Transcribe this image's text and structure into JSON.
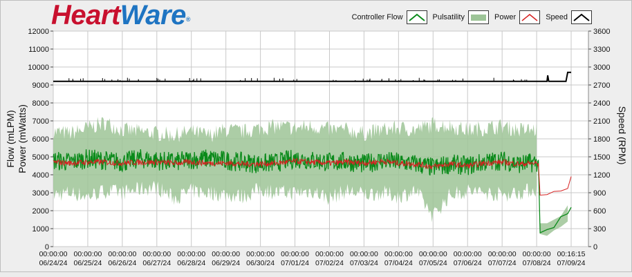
{
  "logo": {
    "part1": "Heart",
    "part2": "Ware",
    "mark": "®"
  },
  "legend": [
    {
      "label": "Controller Flow",
      "icon": "flow-swatch-icon",
      "color": "#0a8a1a"
    },
    {
      "label": "Pulsatility",
      "icon": "pulsatility-swatch-icon",
      "color": "#9dc497"
    },
    {
      "label": "Power",
      "icon": "power-swatch-icon",
      "color": "#d62020"
    },
    {
      "label": "Speed",
      "icon": "speed-swatch-icon",
      "color": "#000000"
    }
  ],
  "chart_data": {
    "type": "line",
    "ylabel_left": [
      "Flow (mLPM)",
      "Power (mWatts)"
    ],
    "ylabel_right": "Speed (RPM)",
    "ylim_left": [
      0,
      12000
    ],
    "ylim_right": [
      0,
      3600
    ],
    "yticks_left": [
      "12000",
      "11000",
      "10000",
      "9000",
      "8000",
      "7000",
      "6000",
      "5000",
      "4000",
      "3000",
      "2000",
      "1000",
      "0"
    ],
    "yticks_right": [
      "3600",
      "3300",
      "3000",
      "2700",
      "2400",
      "2100",
      "1800",
      "1500",
      "1200",
      "900",
      "600",
      "300",
      "0"
    ],
    "xticks": [
      {
        "time": "00:00:00",
        "date": "06/24/24"
      },
      {
        "time": "00:00:00",
        "date": "06/25/24"
      },
      {
        "time": "00:00:00",
        "date": "06/26/24"
      },
      {
        "time": "00:00:00",
        "date": "06/27/24"
      },
      {
        "time": "00:00:00",
        "date": "06/28/24"
      },
      {
        "time": "00:00:00",
        "date": "06/29/24"
      },
      {
        "time": "00:00:00",
        "date": "06/30/24"
      },
      {
        "time": "00:00:00",
        "date": "07/01/24"
      },
      {
        "time": "00:00:00",
        "date": "07/02/24"
      },
      {
        "time": "00:00:00",
        "date": "07/03/24"
      },
      {
        "time": "00:00:00",
        "date": "07/04/24"
      },
      {
        "time": "00:00:00",
        "date": "07/05/24"
      },
      {
        "time": "00:00:00",
        "date": "07/06/24"
      },
      {
        "time": "00:00:00",
        "date": "07/07/24"
      },
      {
        "time": "00:00:00",
        "date": "07/08/24"
      },
      {
        "time": "00:16:15",
        "date": "07/09/24"
      }
    ],
    "grid": true,
    "legend_position": "top-right",
    "series": [
      {
        "name": "Controller Flow",
        "axis": "left",
        "color": "#0a8a1a",
        "x": [
          0,
          0.5,
          1,
          1.5,
          2,
          2.5,
          3,
          3.5,
          4,
          4.5,
          5,
          5.5,
          6,
          6.5,
          7,
          7.5,
          8,
          8.5,
          9,
          9.5,
          10,
          10.5,
          11,
          11.5,
          12,
          12.5,
          13,
          13.5,
          14,
          14.05,
          14.1,
          14.3,
          14.5,
          14.7,
          14.9,
          15.0
        ],
        "y": [
          4800,
          4700,
          4900,
          4800,
          4700,
          4900,
          4800,
          4700,
          4850,
          4900,
          4800,
          4700,
          4600,
          4700,
          4900,
          4800,
          4700,
          4750,
          4600,
          4800,
          4700,
          4600,
          4400,
          4600,
          4500,
          4700,
          4800,
          4600,
          4700,
          4500,
          1000,
          900,
          1200,
          1400,
          1600,
          2200
        ]
      },
      {
        "name": "Power",
        "axis": "left",
        "color": "#d62020",
        "x": [
          0,
          0.5,
          1,
          1.5,
          2,
          2.5,
          3,
          3.5,
          4,
          4.5,
          5,
          5.5,
          6,
          6.5,
          7,
          7.5,
          8,
          8.5,
          9,
          9.5,
          10,
          10.5,
          11,
          11.5,
          12,
          12.5,
          13,
          13.5,
          14,
          14.05,
          14.1,
          14.3,
          14.5,
          14.7,
          14.9,
          15.0
        ],
        "y": [
          4700,
          4650,
          4700,
          4700,
          4650,
          4700,
          4700,
          4650,
          4700,
          4650,
          4650,
          4600,
          4600,
          4650,
          4750,
          4700,
          4650,
          4700,
          4650,
          4750,
          4650,
          4600,
          4450,
          4600,
          4500,
          4650,
          4700,
          4600,
          4650,
          4500,
          2900,
          2950,
          3000,
          3100,
          3300,
          3900
        ]
      },
      {
        "name": "Speed",
        "axis": "right",
        "color": "#000000",
        "x": [
          0,
          14.3,
          14.32,
          14.35,
          14.5,
          14.85,
          14.9,
          15.0
        ],
        "y": [
          2760,
          2760,
          2860,
          2760,
          2760,
          2760,
          2910,
          2910
        ]
      },
      {
        "name": "Pulsatility",
        "axis": "left",
        "color": "#9dc497",
        "x": [
          0,
          0.5,
          1,
          1.5,
          2,
          2.5,
          3,
          3.5,
          4,
          4.5,
          5,
          5.5,
          6,
          6.5,
          7,
          7.5,
          8,
          8.5,
          9,
          9.5,
          10,
          10.5,
          11,
          11.5,
          12,
          12.5,
          13,
          13.5,
          14.0
        ],
        "y_upper": [
          6400,
          6300,
          6600,
          6900,
          6500,
          6400,
          6300,
          6200,
          6400,
          6200,
          6500,
          6400,
          6600,
          6700,
          6600,
          6700,
          6500,
          6500,
          6300,
          6500,
          6600,
          6500,
          6800,
          6700,
          6500,
          6600,
          6700,
          6500,
          6500
        ],
        "y_lower": [
          2900,
          3000,
          2800,
          3100,
          3000,
          3200,
          3300,
          2700,
          3100,
          3000,
          2900,
          2800,
          3200,
          3000,
          3000,
          3100,
          2700,
          3100,
          2900,
          3000,
          2800,
          3100,
          1700,
          2900,
          3100,
          3000,
          2900,
          3000,
          3200
        ]
      }
    ]
  }
}
